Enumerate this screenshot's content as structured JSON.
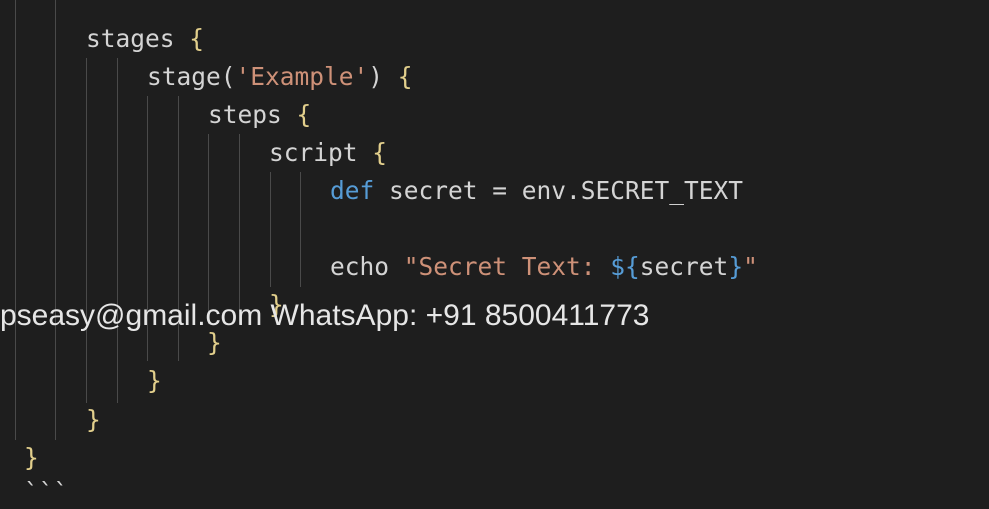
{
  "editor": {
    "lines": {
      "stages": "stages",
      "stage_fn": "stage(",
      "stage_name": "'Example'",
      "stage_close": ")",
      "steps": "steps",
      "script": "script",
      "def_kw": "def",
      "def_rest": " secret = env.SECRET_TEXT",
      "echo": "echo ",
      "echo_str_a": "\"Secret Text: ",
      "interp_open": "${",
      "interp_var": "secret",
      "interp_close": "}",
      "echo_str_b": "\"",
      "open_brace": " {",
      "close_brace": "}",
      "fence": "```"
    }
  },
  "overlay": {
    "contact": "pseasy@gmail.com WhatsApp: +91 8500411773"
  },
  "colors": {
    "background": "#1e1e1e",
    "keyword": "#569cd6",
    "string": "#ce9178",
    "text": "#d4d4d4"
  }
}
